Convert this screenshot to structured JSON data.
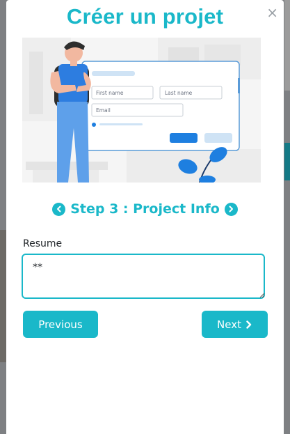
{
  "modal": {
    "title": "Créer un projet",
    "close_glyph": "×"
  },
  "illustration": {
    "form": {
      "first_name_placeholder": "First name",
      "last_name_placeholder": "Last name",
      "email_placeholder": "Email"
    }
  },
  "step": {
    "label": "Step 3 : Project Info",
    "prev_icon": "chevron-left-circle-icon",
    "next_icon": "chevron-right-circle-icon"
  },
  "form": {
    "resume_label": "Resume",
    "resume_value": "**"
  },
  "buttons": {
    "previous_label": "Previous",
    "next_label": "Next",
    "next_icon": "chevron-right-icon"
  },
  "colors": {
    "accent": "#1ab8c9",
    "overlay": "#7e8083",
    "illustration_bg": "#f5f5f5",
    "illustration_blue": "#1e7fe0"
  }
}
